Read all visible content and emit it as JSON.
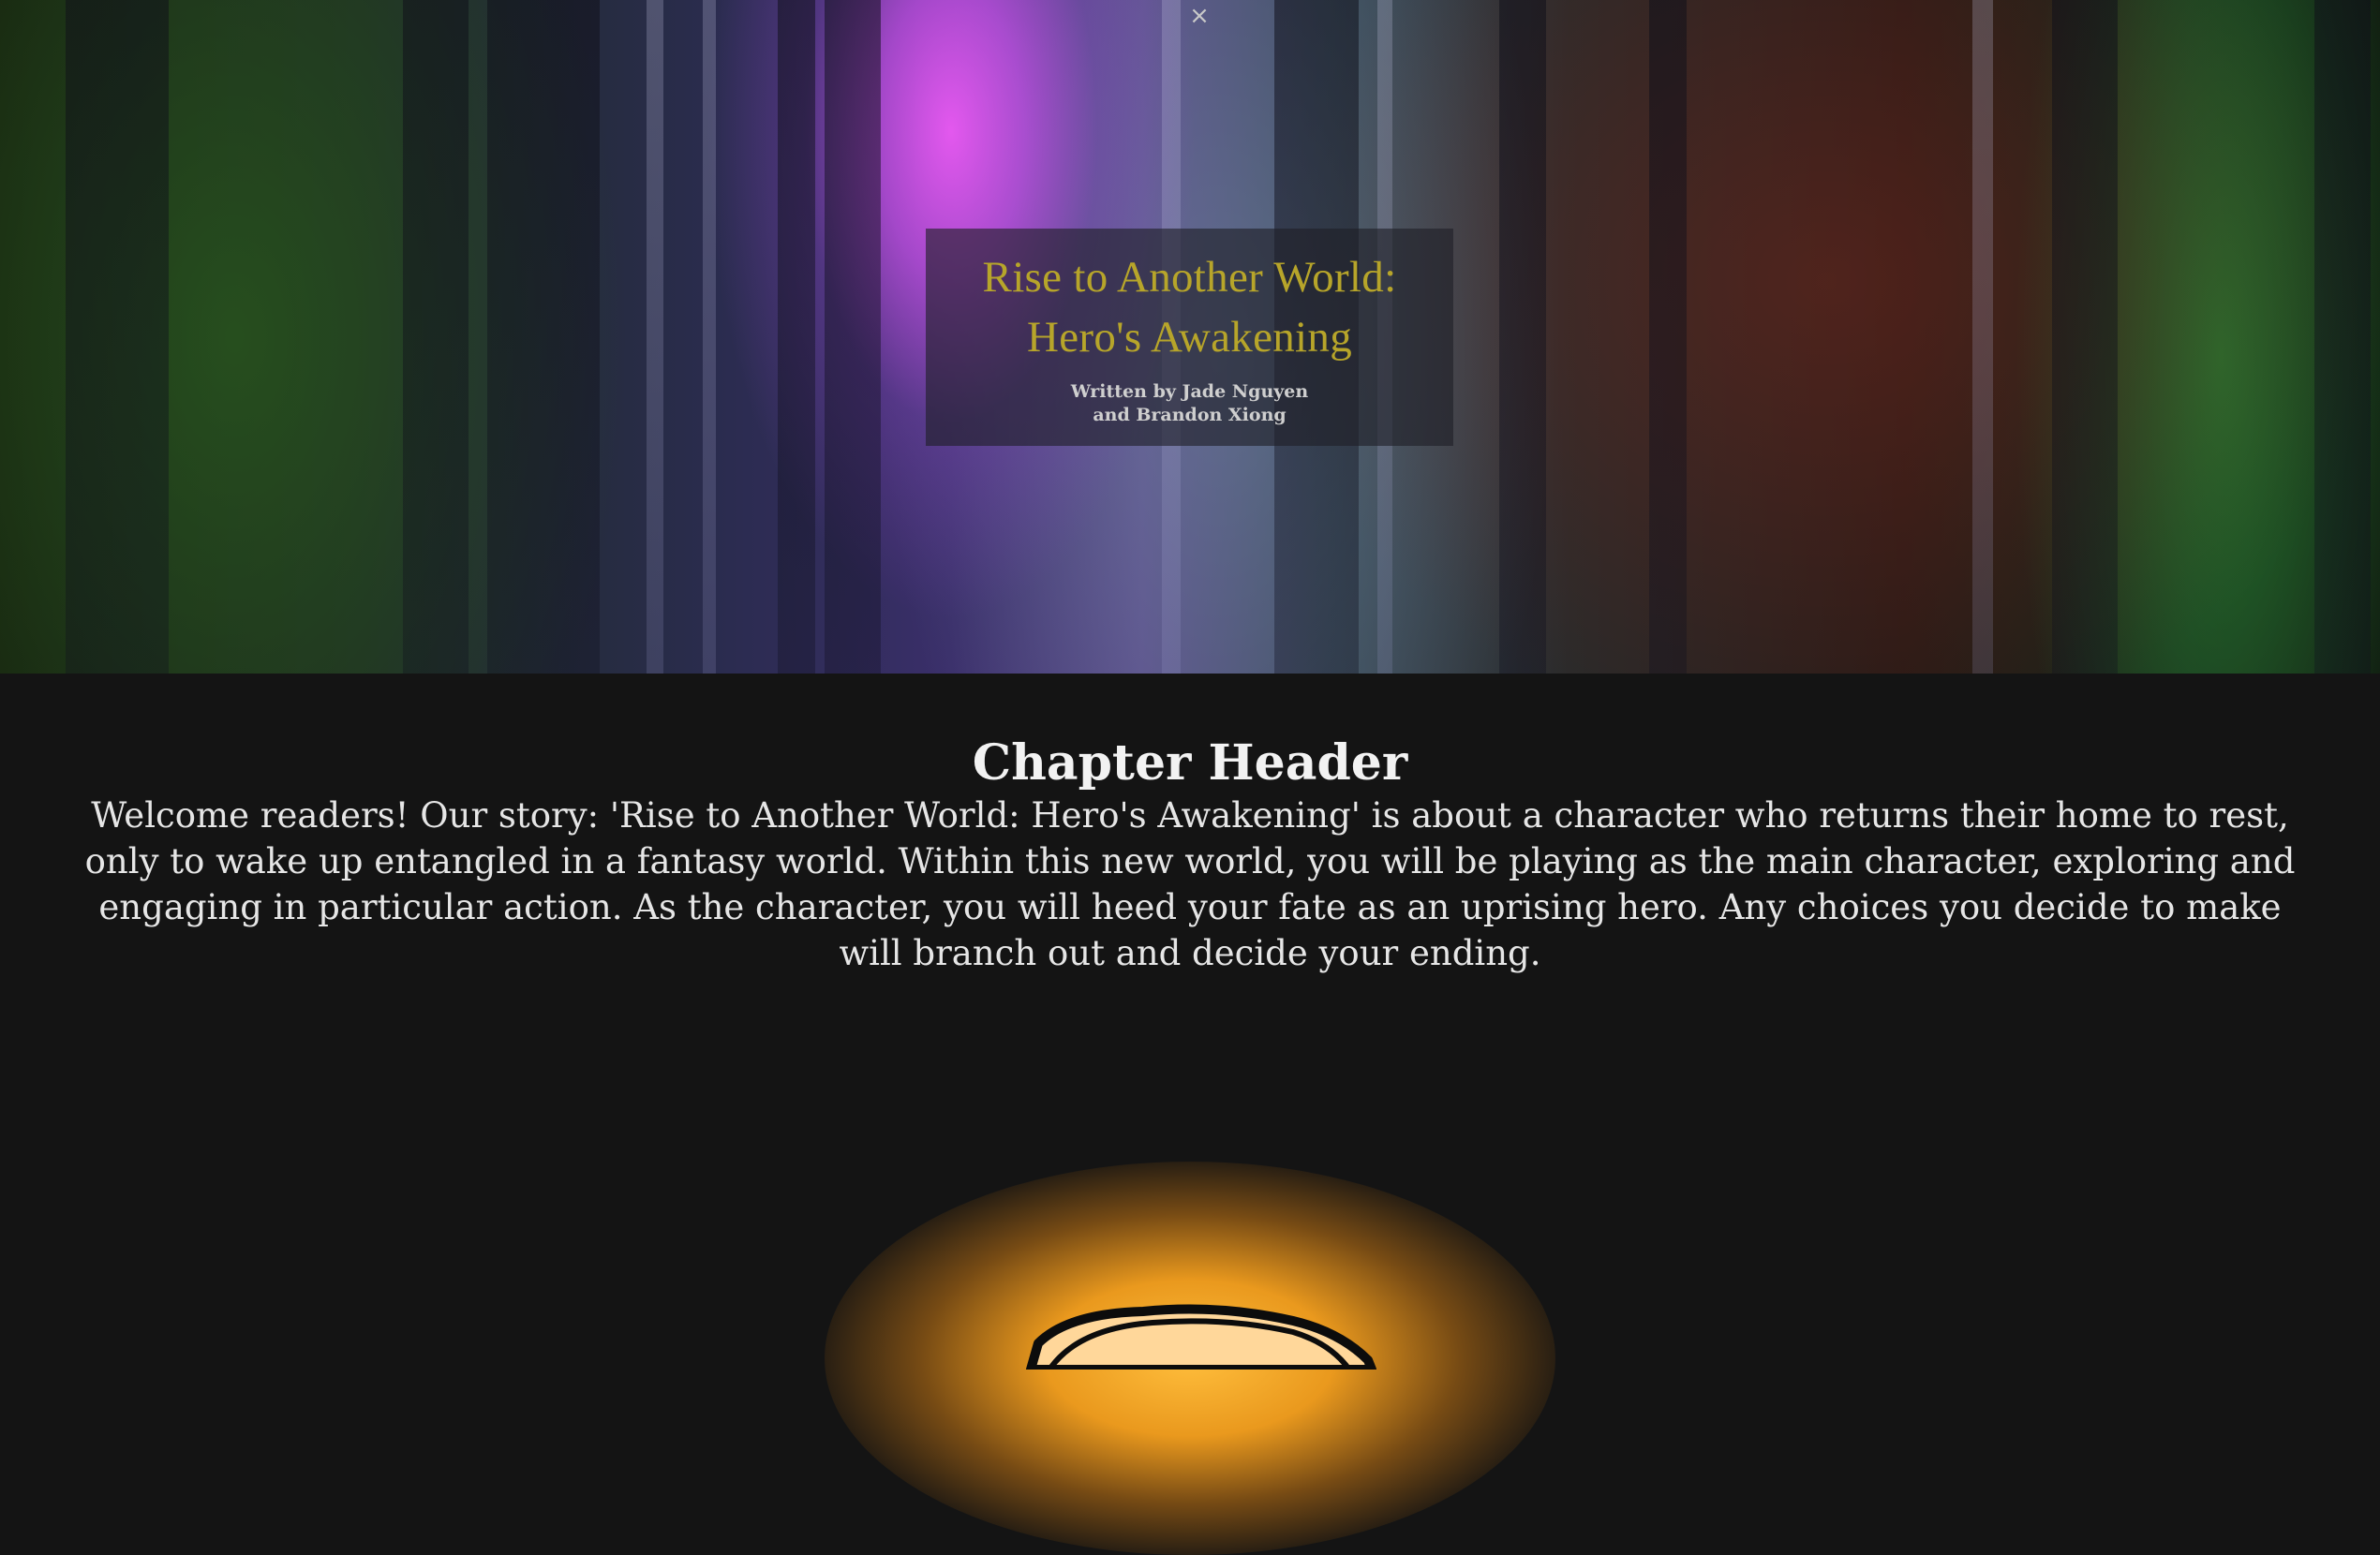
{
  "hero": {
    "title_line_1": "Rise to Another World:",
    "title_line_2": "Hero's Awakening",
    "byline_line_1": "Written by Jade Nguyen",
    "byline_line_2": "and Brandon Xiong",
    "close_icon": "×"
  },
  "content": {
    "chapter_header": "Chapter Header",
    "intro": "Welcome readers! Our story: 'Rise to Another World: Hero's Awakening' is about a character who returns their home to rest, only to wake up entangled in a fantasy world. Within this new world, you will be playing as the main character, exploring and engaging in particular action. As the character, you will heed your fate as an uprising hero. Any choices you decide to make will branch out and decide your ending."
  },
  "colors": {
    "page_background": "#141414",
    "title_gold": "#b7a52a",
    "glow_orange": "#f5a01e"
  },
  "icons": {
    "close": "close-icon"
  }
}
